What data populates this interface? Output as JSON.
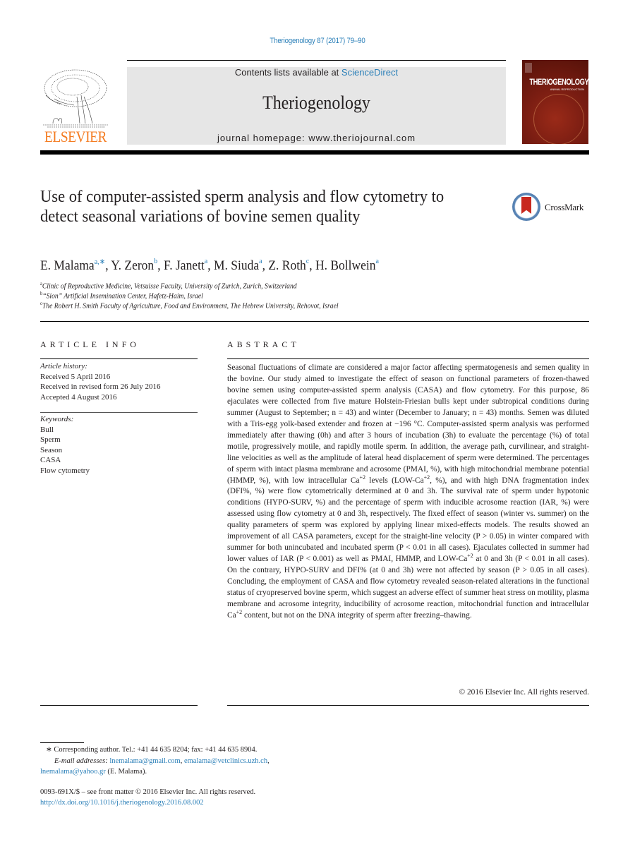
{
  "header": {
    "citation": "Theriogenology 87 (2017) 79–90",
    "contents_prefix": "Contents lists available at ",
    "contents_link": "ScienceDirect",
    "journal_name": "Theriogenology",
    "homepage": "journal homepage: www.theriojournal.com",
    "publisher_logo_text": "ELSEVIER",
    "cover_title": "THERIOGENOLOGY",
    "cover_subtitle": "ANIMAL REPRODUCTION",
    "crossmark_label": "CrossMark"
  },
  "article": {
    "title": "Use of computer-assisted sperm analysis and flow cytometry to detect seasonal variations of bovine semen quality",
    "authors": [
      {
        "name": "E. Malama",
        "sup": "a,∗"
      },
      {
        "name": "Y. Zeron",
        "sup": "b"
      },
      {
        "name": "F. Janett",
        "sup": "a"
      },
      {
        "name": "M. Siuda",
        "sup": "a"
      },
      {
        "name": "Z. Roth",
        "sup": "c"
      },
      {
        "name": "H. Bollwein",
        "sup": "a"
      }
    ],
    "affiliations": [
      {
        "key": "a",
        "text": "Clinic of Reproductive Medicine, Vetsuisse Faculty, University of Zurich, Zurich, Switzerland"
      },
      {
        "key": "b",
        "text": "“Sion” Artificial Insemination Center, Hafetz-Haim, Israel"
      },
      {
        "key": "c",
        "text": "The Robert H. Smith Faculty of Agriculture, Food and Environment, The Hebrew University, Rehovot, Israel"
      }
    ]
  },
  "article_info": {
    "heading": "ARTICLE INFO",
    "history_label": "Article history:",
    "received": "Received 5 April 2016",
    "revised": "Received in revised form 26 July 2016",
    "accepted": "Accepted 4 August 2016",
    "keywords_label": "Keywords:",
    "keywords": [
      "Bull",
      "Sperm",
      "Season",
      "CASA",
      "Flow cytometry"
    ]
  },
  "abstract": {
    "heading": "ABSTRACT",
    "p1": "Seasonal fluctuations of climate are considered a major factor affecting spermatogenesis and semen quality in the bovine. Our study aimed to investigate the effect of season on functional parameters of frozen-thawed bovine semen using computer-assisted sperm analysis (CASA) and flow cytometry. For this purpose, 86 ejaculates were collected from five mature Holstein-Friesian bulls kept under subtropical conditions during summer (August to September; n = 43) and winter (December to January; n = 43) months. Semen was diluted with a Tris-egg yolk-based extender and frozen at −196 °C. Computer-assisted sperm analysis was performed immediately after thawing (0h) and after 3 hours of incubation (3h) to evaluate the percentage (%) of total motile, progressively motile, and rapidly motile sperm. In addition, the average path, curvilinear, and straight-line velocities as well as the amplitude of lateral head displacement of sperm were determined. The percentages of sperm with intact plasma membrane and acrosome (PMAI, %), with high mitochondrial membrane potential (HMMP, %), with low intracellular Ca",
    "p2": " levels (LOW-Ca",
    "p3": ", %), and with high DNA fragmentation index (DFI%, %) were flow cytometrically determined at 0 and 3h. The survival rate of sperm under hypotonic conditions (HYPO-SURV, %) and the percentage of sperm with inducible acrosome reaction (IAR, %) were assessed using flow cytometry at 0 and 3h, respectively. The fixed effect of season (winter vs. summer) on the quality parameters of sperm was explored by applying linear mixed-effects models. The results showed an improvement of all CASA parameters, except for the straight-line velocity (P > 0.05) in winter compared with summer for both unincubated and incubated sperm (P < 0.01 in all cases). Ejaculates collected in summer had lower values of IAR (P < 0.001) as well as PMAI, HMMP, and LOW-Ca",
    "p4": " at 0 and 3h (P < 0.01 in all cases). On the contrary, HYPO-SURV and DFI% (at 0 and 3h) were not affected by season (P > 0.05 in all cases). Concluding, the employment of CASA and flow cytometry revealed season-related alterations in the functional status of cryopreserved bovine sperm, which suggest an adverse effect of summer heat stress on motility, plasma membrane and acrosome integrity, inducibility of acrosome reaction, mitochondrial function and intracellular Ca",
    "p5": " content, but not on the DNA integrity of sperm after freezing–thawing.",
    "ca_sup": "+2",
    "copyright": "© 2016 Elsevier Inc. All rights reserved."
  },
  "footnotes": {
    "corresponding": "∗ Corresponding author. Tel.: +41 44 635 8204; fax: +41 44 635 8904.",
    "email_label": "E-mail addresses:",
    "email1": "lnemalama@gmail.com",
    "email2": "emalama@vetclinics.uzh.ch",
    "email3": "lnemalama@yahoo.gr",
    "email_owner": " (E. Malama).",
    "issn": "0093-691X/$ – see front matter © 2016 Elsevier Inc. All rights reserved.",
    "doi": "http://dx.doi.org/10.1016/j.theriogenology.2016.08.002"
  }
}
